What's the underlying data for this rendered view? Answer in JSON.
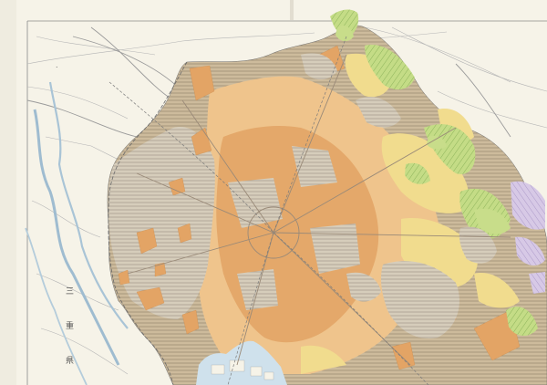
{
  "map": {
    "colors": {
      "paper": "#f5f2e6",
      "urban_core": "#e4a86a",
      "urban_light": "#efc48c",
      "paddy_hatch": "#c9b79a",
      "upland_yellow": "#f1dc8e",
      "forest_green": "#c8dd8a",
      "hill_green": "#9cc36a",
      "orchard_purple": "#c8b6dc",
      "water": "#cfe1ec",
      "river": "#9fbcd0",
      "roads": "#a9a9a9"
    },
    "labels": {
      "west_a": "三",
      "west_b": "重",
      "west_c": "県"
    }
  }
}
